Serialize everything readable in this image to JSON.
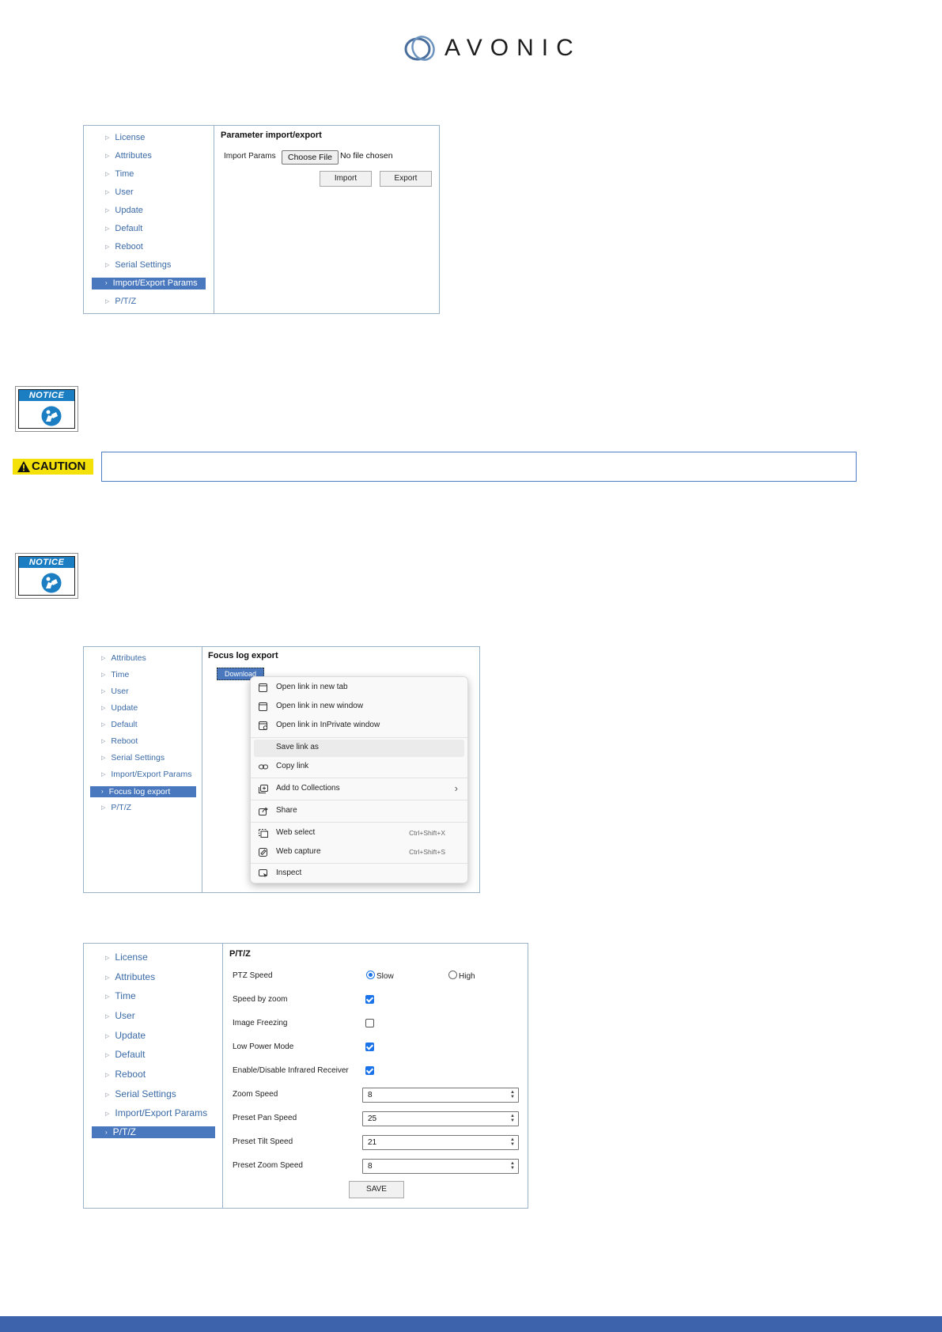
{
  "logo": {
    "text": "AVONIC"
  },
  "screen1": {
    "nav": [
      "License",
      "Attributes",
      "Time",
      "User",
      "Update",
      "Default",
      "Reboot",
      "Serial Settings",
      "Import/Export Params",
      "P/T/Z"
    ],
    "active_index": 8,
    "title": "Parameter import/export",
    "import_label": "Import Params",
    "choose_file": "Choose File",
    "no_file": "No file chosen",
    "import_button": "Import",
    "export_button": "Export"
  },
  "notice": {
    "label": "NOTICE"
  },
  "caution": {
    "label": "CAUTION"
  },
  "screen2": {
    "nav": [
      "Attributes",
      "Time",
      "User",
      "Update",
      "Default",
      "Reboot",
      "Serial Settings",
      "Import/Export Params",
      "Focus log export",
      "P/T/Z"
    ],
    "active_index": 8,
    "title": "Focus log export",
    "download_button": "Download",
    "menu": {
      "open_new_tab": "Open link in new tab",
      "open_new_window": "Open link in new window",
      "open_inprivate": "Open link in InPrivate window",
      "save_link": "Save link as",
      "copy_link": "Copy link",
      "add_collections": "Add to Collections",
      "share": "Share",
      "web_select": "Web select",
      "web_select_shortcut": "Ctrl+Shift+X",
      "web_capture": "Web capture",
      "web_capture_shortcut": "Ctrl+Shift+S",
      "inspect": "Inspect"
    }
  },
  "screen3": {
    "nav": [
      "License",
      "Attributes",
      "Time",
      "User",
      "Update",
      "Default",
      "Reboot",
      "Serial Settings",
      "Import/Export Params",
      "P/T/Z"
    ],
    "active_index": 9,
    "title": "P/T/Z",
    "ptz_speed_label": "PTZ Speed",
    "slow_label": "Slow",
    "high_label": "High",
    "ptz_speed_value": "Slow",
    "speed_by_zoom_label": "Speed by zoom",
    "speed_by_zoom": true,
    "image_freezing_label": "Image Freezing",
    "image_freezing": false,
    "low_power_label": "Low Power Mode",
    "low_power": true,
    "infrared_label": "Enable/Disable Infrared Receiver",
    "infrared": true,
    "zoom_speed_label": "Zoom Speed",
    "zoom_speed": "8",
    "preset_pan_label": "Preset Pan Speed",
    "preset_pan": "25",
    "preset_tilt_label": "Preset Tilt Speed",
    "preset_tilt": "21",
    "preset_zoom_label": "Preset Zoom Speed",
    "preset_zoom": "8",
    "save_button": "SAVE"
  },
  "colors": {
    "accent": "#4a78be",
    "footer": "#3c63ac",
    "caution": "#f4e10a",
    "notice": "#1b7ec2"
  }
}
